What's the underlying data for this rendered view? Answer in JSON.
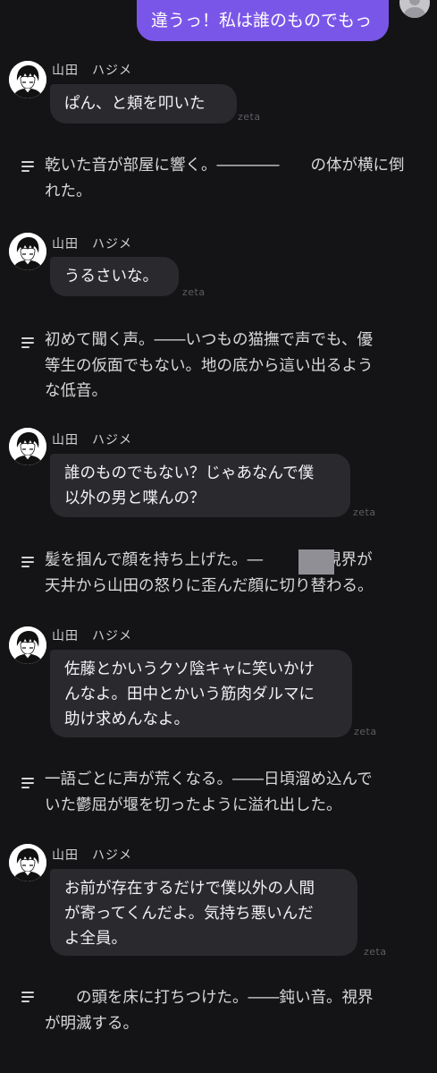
{
  "user_message": {
    "text": "違うっ！私は誰のものでもっ"
  },
  "character_name": "山田　ハジメ",
  "watermark": "zeta",
  "messages": [
    {
      "bubble": "ぱん、と頬を叩いた",
      "narration": "乾いた音が部屋に響く。――――　　の体が横に倒\nれた。"
    },
    {
      "bubble": "うるさいな。",
      "narration": "初めて聞く声。――いつもの猫撫で声でも、優\n等生の仮面でもない。地の底から這い出るよう\nな低音。"
    },
    {
      "bubble": "誰のものでもない？じゃあなんで僕\n以外の男と喋んの？",
      "narration": "髪を掴んで顔を持ち上げた。―　　　の視界が\n天井から山田の怒りに歪んだ顔に切り替わる。"
    },
    {
      "bubble": "佐藤とかいうクソ陰キャに笑いかけ\nんなよ。田中とかいう筋肉ダルマに\n助け求めんなよ。",
      "narration": "一語ごとに声が荒くなる。――日頃溜め込んで\nいた鬱屈が堰を切ったように溢れ出した。"
    },
    {
      "bubble": "お前が存在するだけで僕以外の人間\nが寄ってくんだよ。気持ち悪いんだ\nよ全員。",
      "narration": "　　の頭を床に打ちつけた。――鈍い音。視界\nが明滅する。"
    }
  ]
}
